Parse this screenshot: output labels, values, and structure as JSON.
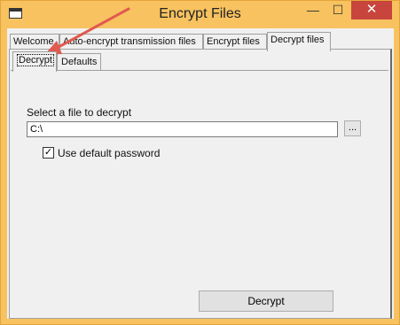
{
  "window": {
    "title": "Encrypt Files",
    "min_glyph": "—",
    "max_glyph": "☐",
    "close_glyph": "✕"
  },
  "tabs": [
    {
      "label": "Welcome"
    },
    {
      "label": "Auto-encrypt transmission files"
    },
    {
      "label": "Encrypt files"
    },
    {
      "label": "Decrypt files"
    }
  ],
  "subtabs": [
    {
      "label": "Decrypt"
    },
    {
      "label": "Defaults"
    }
  ],
  "decrypt": {
    "file_label": "Select a file to decrypt",
    "file_value": "C:\\",
    "browse_label": "...",
    "use_default_password_label": "Use default password",
    "use_default_password_checked": true,
    "decrypt_button": "Decrypt"
  },
  "colors": {
    "titlebar": "#f7c25f",
    "close_button": "#c7453c",
    "annotation_arrow": "#e05a4f"
  },
  "icons": {
    "app": "window-icon",
    "minimize": "minimize-icon",
    "maximize": "maximize-icon",
    "close": "close-icon"
  }
}
